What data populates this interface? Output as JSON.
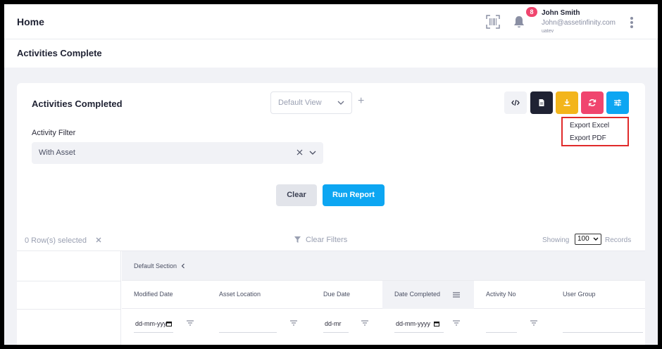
{
  "header": {
    "title": "Home",
    "notification_count": "8",
    "user_name": "John Smith",
    "user_email": "John@assetinfinity.com",
    "user_sub": "uatev"
  },
  "page": {
    "title": "Activities Complete"
  },
  "card": {
    "title": "Activities Completed",
    "view_select": "Default View",
    "plus": "+",
    "export_menu": [
      "Export Excel",
      "Export PDF"
    ],
    "filter_label": "Activity Filter",
    "filter_value": "With Asset",
    "clear_label": "Clear",
    "run_label": "Run Report"
  },
  "table_bar": {
    "rows_selected": "0 Row(s) selected",
    "clear_filters": "Clear Filters",
    "showing": "Showing",
    "page_size": "100",
    "records": "Records"
  },
  "grid": {
    "section": "Default Section",
    "columns": [
      "Modified Date",
      "Asset Location",
      "Due Date",
      "Date Completed",
      "Activity No",
      "User Group"
    ],
    "filters": {
      "modified_date": "dd-mm-yyy",
      "due_date": "dd-mr",
      "date_completed": "dd-mm-yyyy"
    }
  },
  "colors": {
    "accent": "#0da6f2",
    "danger": "#f0456e",
    "warning": "#f3b51b",
    "dark": "#1f2233",
    "highlight_border": "#e02b2b"
  }
}
